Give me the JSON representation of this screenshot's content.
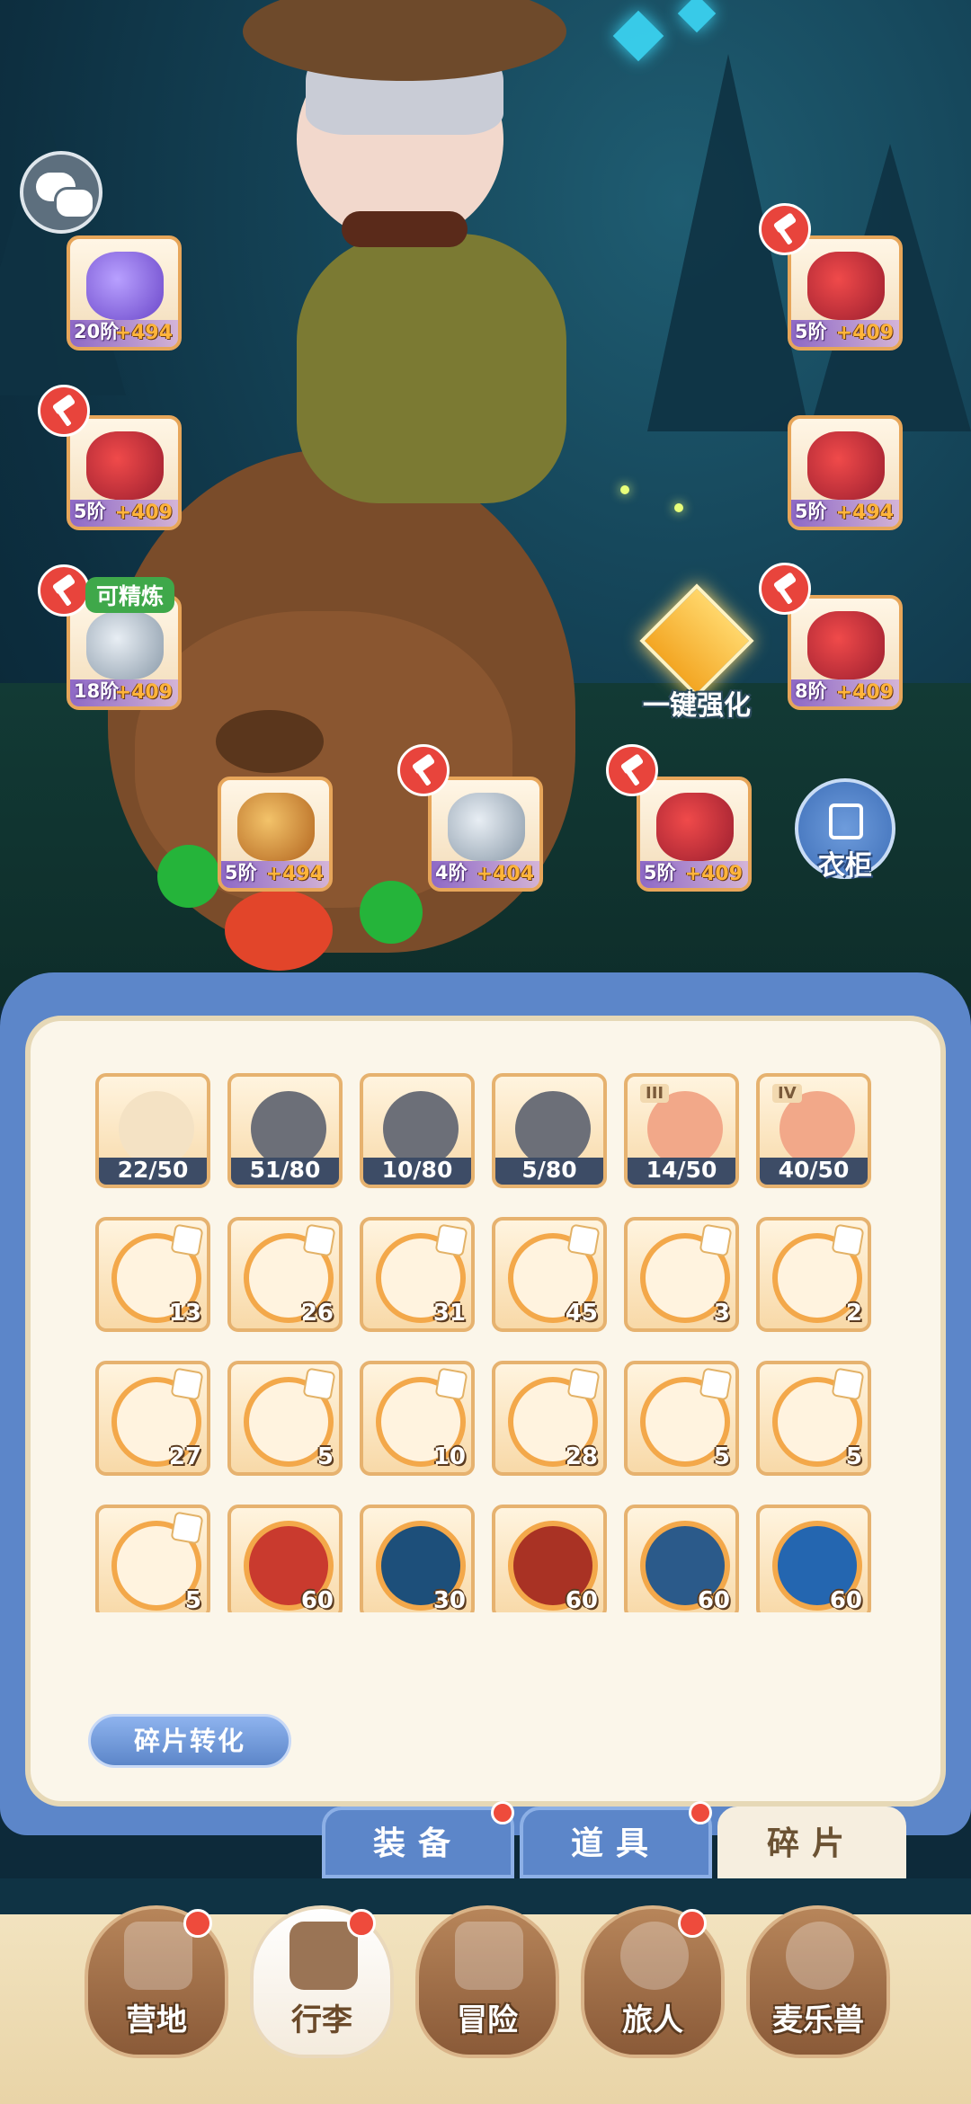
{
  "equipment": [
    {
      "slot": "head-accessory",
      "level": "20阶",
      "bonus": "+494",
      "hammer": false,
      "refine": false
    },
    {
      "slot": "helmet",
      "level": "5阶",
      "bonus": "+409",
      "hammer": true,
      "refine": false
    },
    {
      "slot": "armor",
      "level": "5阶",
      "bonus": "+409",
      "hammer": true,
      "refine": false
    },
    {
      "slot": "gloves",
      "level": "5阶",
      "bonus": "+494",
      "hammer": false,
      "refine": false
    },
    {
      "slot": "pants",
      "level": "18阶",
      "bonus": "+409",
      "hammer": true,
      "refine": true
    },
    {
      "slot": "boots",
      "level": "8阶",
      "bonus": "+409",
      "hammer": true,
      "refine": false
    },
    {
      "slot": "ring",
      "level": "5阶",
      "bonus": "+494",
      "hammer": false,
      "refine": false
    },
    {
      "slot": "necklace",
      "level": "4阶",
      "bonus": "+404",
      "hammer": true,
      "refine": false
    },
    {
      "slot": "amulet",
      "level": "5阶",
      "bonus": "+409",
      "hammer": true,
      "refine": false
    }
  ],
  "labels": {
    "refine_tag": "可精炼",
    "enhance": "一键强化",
    "wardrobe": "衣柜",
    "convert": "碎片转化"
  },
  "inventory_tabs": [
    {
      "label": "装备",
      "active": false,
      "dot": true
    },
    {
      "label": "道具",
      "active": false,
      "dot": true
    },
    {
      "label": "碎片",
      "active": true,
      "dot": false
    }
  ],
  "grid_row1": [
    {
      "item": "scroll",
      "progress": "22/50"
    },
    {
      "item": "fire-ore",
      "progress": "51/80"
    },
    {
      "item": "purple-ore",
      "progress": "10/80"
    },
    {
      "item": "blue-ore",
      "progress": "5/80"
    },
    {
      "item": "glove-III",
      "roman": "III",
      "progress": "14/50"
    },
    {
      "item": "glove-IV",
      "roman": "IV",
      "progress": "40/50"
    }
  ],
  "grid_rows": [
    [
      "13",
      "26",
      "31",
      "45",
      "3",
      "2"
    ],
    [
      "27",
      "5",
      "10",
      "28",
      "5",
      "5"
    ],
    [
      "5",
      "60",
      "30",
      "60",
      "60",
      "60"
    ]
  ],
  "bottom_nav": [
    {
      "label": "营地",
      "active": false,
      "dot": true
    },
    {
      "label": "行李",
      "active": true,
      "dot": true
    },
    {
      "label": "冒险",
      "active": false,
      "dot": false
    },
    {
      "label": "旅人",
      "active": false,
      "dot": true
    },
    {
      "label": "麦乐兽",
      "active": false,
      "dot": false
    }
  ],
  "colors": {
    "accent_blue": "#5c86c9",
    "badge_red": "#ee4b3c",
    "gold": "#f3a623"
  }
}
